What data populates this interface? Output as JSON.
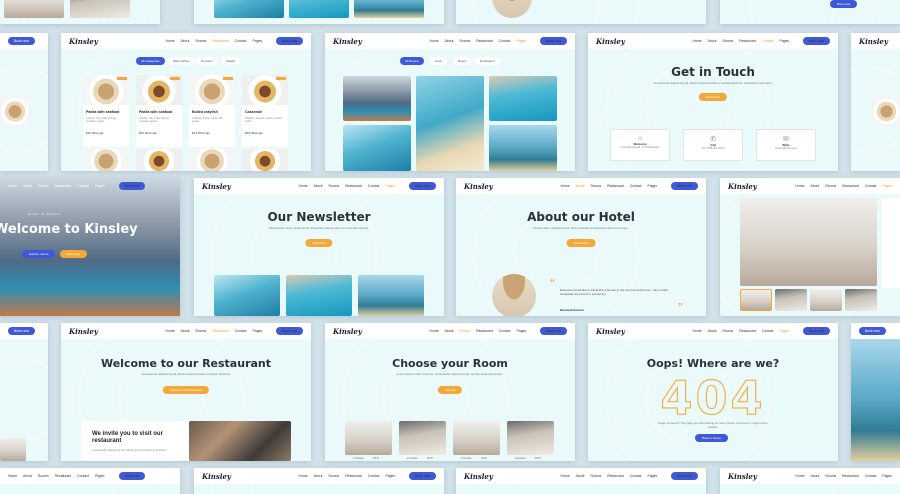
{
  "brand": {
    "logo": "Kinsley",
    "book_label": "Book now",
    "colors": {
      "accent": "#f4a83a",
      "primary": "#3f58d6",
      "card_bg": "#eaf9fa"
    }
  },
  "nav_links": [
    "Home",
    "About",
    "Rooms",
    "Restaurant",
    "Contact",
    "Pages"
  ],
  "pages": {
    "restaurant_menu": {
      "filters": [
        "All Categories",
        "Main dishes",
        "Desserts",
        "Salads"
      ],
      "dishes": [
        {
          "name": "Paella with seafood",
          "desc": "Lobster, rice, crab, shrimp, mussels, spices",
          "price": "$45.00/single"
        },
        {
          "name": "Paella with seafood",
          "desc": "Lobster, rice, crab, shrimp, mussels, spices",
          "price": "$45.00/single"
        },
        {
          "name": "Boiled crayfish",
          "desc": "Crayfish, lemon, garlic, dill, spices",
          "price": "$43.00/single"
        },
        {
          "name": "Casserole",
          "desc": "Chicken, cheese, potato, spices, herbs",
          "price": "$38.00/single"
        }
      ]
    },
    "gallery": {
      "filters": [
        "All Rooms",
        "Hotel",
        "Beach",
        "Restaurant"
      ]
    },
    "contact": {
      "title": "Get in Touch",
      "subtitle": "Consectetur adipiscing elit. Morbi euismod tellus et iaculis faucibus. Vestibulum sed tortor.",
      "button": "Contact us",
      "items": [
        {
          "title": "Welcome",
          "value": "Grand Boulevard, 12 Philadelphia"
        },
        {
          "title": "Call",
          "value": "+01 7538 462 08 09"
        },
        {
          "title": "Write",
          "value": "kinsley@hotel.com"
        }
      ]
    },
    "welcome_hero": {
      "eyebrow": "Hotel & Resort",
      "title": "Welcome to Kinsley",
      "button_a": "Explore rooms",
      "button_b": "Book now"
    },
    "newsletter": {
      "title": "Our Newsletter",
      "subtitle": "Ullamcorper nunc eleifend nisl. Phasellus aliquet justo ut commodo lobortis.",
      "button": "Subscribe"
    },
    "about": {
      "title": "About our Hotel",
      "subtitle": "Ornare diam, adipiscing elit. Duis molestie consectetur ultrices mi lorem.",
      "button": "Read more",
      "quote": "Everyone would like to travel like a human in the forest and at home – like a hotel. Hospitality as a word to spread joy.",
      "author": "Briana Robinson"
    },
    "restaurant_welcome": {
      "title": "Welcome to our Restaurant",
      "subtitle": "Consectetur adipiscing elit, Morbi euismod tellus et iaculis faucibus.",
      "button": "Discover our Restaurant",
      "invite_title": "We invite you to visit our restaurant",
      "invite_text": "Consectetur adipiscing elit. Morbi euismod tellus et faucibus."
    },
    "rooms": {
      "title": "Choose your Room",
      "subtitle": "Lorem ipsum dolor sit amet, consectetur adipiscing elit, sed do eiusmod tempor.",
      "button": "View all",
      "room_meta": [
        "2 Guests",
        "18 ft²"
      ]
    },
    "not_found": {
      "title": "Oops! Where are we?",
      "code": "404",
      "subtitle": "Page not found! The page you are looking for was moved, removed or might never existed.",
      "button": "Back to Home"
    }
  }
}
